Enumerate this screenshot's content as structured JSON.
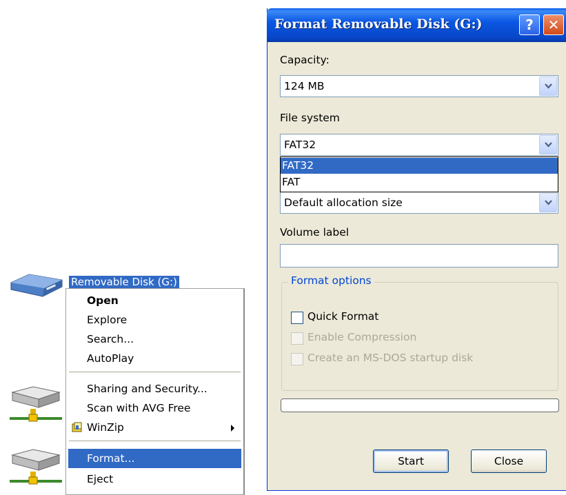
{
  "desktop": {
    "removable_label": "Removable Disk (G:)"
  },
  "context_menu": {
    "items": [
      {
        "label": "Open",
        "default": true
      },
      {
        "label": "Explore"
      },
      {
        "label": "Search..."
      },
      {
        "label": "AutoPlay"
      },
      {
        "label": "Sharing and Security..."
      },
      {
        "label": "Scan with AVG Free"
      },
      {
        "label": "WinZip",
        "has_submenu": true,
        "icon": "winzip-icon"
      },
      {
        "label": "Format...",
        "highlighted": true
      },
      {
        "label": "Eject"
      }
    ]
  },
  "dialog": {
    "title": "Format Removable Disk (G:)",
    "help_glyph": "?",
    "close_glyph": "✕",
    "capacity_label": "Capacity:",
    "capacity_value": "124 MB",
    "file_system_label": "File system",
    "file_system_value": "FAT32",
    "file_system_options": [
      "FAT32",
      "FAT"
    ],
    "file_system_selected": "FAT32",
    "allocation_value": "Default allocation size",
    "volume_label_label": "Volume label",
    "volume_label_value": "",
    "format_options_title": "Format options",
    "options": [
      {
        "label": "Quick Format",
        "checked": false,
        "enabled": true
      },
      {
        "label": "Enable Compression",
        "checked": false,
        "enabled": false
      },
      {
        "label": "Create an MS-DOS startup disk",
        "checked": false,
        "enabled": false
      }
    ],
    "progress": 0,
    "start_label": "Start",
    "close_label": "Close"
  },
  "colors": {
    "selection": "#316ac5",
    "titlebar": "#0b57e3",
    "dialog_bg": "#ece9d8",
    "group_title": "#0046d5"
  }
}
